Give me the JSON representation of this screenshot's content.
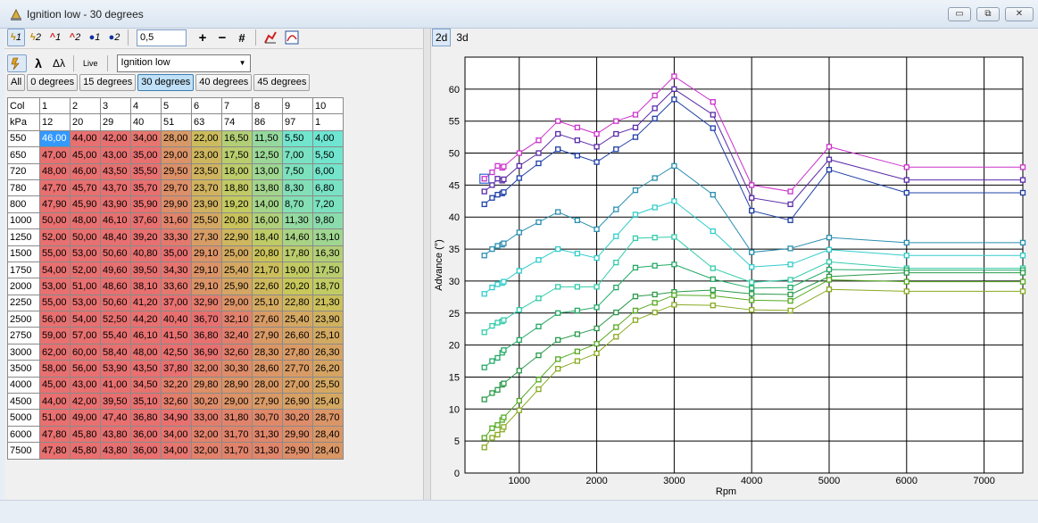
{
  "window": {
    "title": "Ignition low - 30 degrees",
    "buttons": {
      "minimize": "▭",
      "restore": "⧉",
      "close": "✕"
    }
  },
  "toolbar": {
    "buttons": [
      {
        "name": "spark-1",
        "sym": "ϟ",
        "sub": "1",
        "style": "yel",
        "active": true
      },
      {
        "name": "spark-2",
        "sym": "ϟ",
        "sub": "2",
        "style": "yel",
        "active": false
      },
      {
        "name": "red-1",
        "sym": "^",
        "sub": "1",
        "style": "red",
        "active": false
      },
      {
        "name": "red-2",
        "sym": "^",
        "sub": "2",
        "style": "red",
        "active": false
      },
      {
        "name": "blue-1",
        "sym": "●",
        "sub": "1",
        "style": "blue",
        "active": false
      },
      {
        "name": "blue-2",
        "sym": "●",
        "sub": "2",
        "style": "blue",
        "active": false
      }
    ],
    "step_value": "0,5",
    "plus": "+",
    "minus": "−",
    "hash": "#"
  },
  "toolbar2": {
    "lambda": "λ",
    "delta_lambda": "Δλ",
    "live": "Live",
    "map_select": "Ignition low"
  },
  "tabs": [
    {
      "label": "All",
      "active": false
    },
    {
      "label": "0 degrees",
      "active": false
    },
    {
      "label": "15 degrees",
      "active": false
    },
    {
      "label": "30 degrees",
      "active": true
    },
    {
      "label": "40 degrees",
      "active": false
    },
    {
      "label": "45 degrees",
      "active": false
    }
  ],
  "table": {
    "col_label": "Col",
    "cols": [
      "1",
      "2",
      "3",
      "4",
      "5",
      "6",
      "7",
      "8",
      "9",
      "10"
    ],
    "kpa_label": "kPa",
    "kpa": [
      "12",
      "20",
      "29",
      "40",
      "51",
      "63",
      "74",
      "86",
      "97",
      "1"
    ],
    "rows": [
      {
        "rpm": "550",
        "v": [
          "46,00",
          "44,00",
          "42,00",
          "34,00",
          "28,00",
          "22,00",
          "16,50",
          "11,50",
          "5,50",
          "4,00"
        ]
      },
      {
        "rpm": "650",
        "v": [
          "47,00",
          "45,00",
          "43,00",
          "35,00",
          "29,00",
          "23,00",
          "17,50",
          "12,50",
          "7,00",
          "5,50"
        ]
      },
      {
        "rpm": "720",
        "v": [
          "48,00",
          "46,00",
          "43,50",
          "35,50",
          "29,50",
          "23,50",
          "18,00",
          "13,00",
          "7,50",
          "6,00"
        ]
      },
      {
        "rpm": "780",
        "v": [
          "47,70",
          "45,70",
          "43,70",
          "35,70",
          "29,70",
          "23,70",
          "18,80",
          "13,80",
          "8,30",
          "6,80"
        ]
      },
      {
        "rpm": "800",
        "v": [
          "47,90",
          "45,90",
          "43,90",
          "35,90",
          "29,90",
          "23,90",
          "19,20",
          "14,00",
          "8,70",
          "7,20"
        ]
      },
      {
        "rpm": "1000",
        "v": [
          "50,00",
          "48,00",
          "46,10",
          "37,60",
          "31,60",
          "25,50",
          "20,80",
          "16,00",
          "11,30",
          "9,80"
        ]
      },
      {
        "rpm": "1250",
        "v": [
          "52,00",
          "50,00",
          "48,40",
          "39,20",
          "33,30",
          "27,30",
          "22,90",
          "18,40",
          "14,60",
          "13,10"
        ]
      },
      {
        "rpm": "1500",
        "v": [
          "55,00",
          "53,00",
          "50,60",
          "40,80",
          "35,00",
          "29,10",
          "25,00",
          "20,80",
          "17,80",
          "16,30"
        ]
      },
      {
        "rpm": "1750",
        "v": [
          "54,00",
          "52,00",
          "49,60",
          "39,50",
          "34,30",
          "29,10",
          "25,40",
          "21,70",
          "19,00",
          "17,50"
        ]
      },
      {
        "rpm": "2000",
        "v": [
          "53,00",
          "51,00",
          "48,60",
          "38,10",
          "33,60",
          "29,10",
          "25,90",
          "22,60",
          "20,20",
          "18,70"
        ]
      },
      {
        "rpm": "2250",
        "v": [
          "55,00",
          "53,00",
          "50,60",
          "41,20",
          "37,00",
          "32,90",
          "29,00",
          "25,10",
          "22,80",
          "21,30"
        ]
      },
      {
        "rpm": "2500",
        "v": [
          "56,00",
          "54,00",
          "52,50",
          "44,20",
          "40,40",
          "36,70",
          "32,10",
          "27,60",
          "25,40",
          "23,90"
        ]
      },
      {
        "rpm": "2750",
        "v": [
          "59,00",
          "57,00",
          "55,40",
          "46,10",
          "41,50",
          "36,80",
          "32,40",
          "27,90",
          "26,60",
          "25,10"
        ]
      },
      {
        "rpm": "3000",
        "v": [
          "62,00",
          "60,00",
          "58,40",
          "48,00",
          "42,50",
          "36,90",
          "32,60",
          "28,30",
          "27,80",
          "26,30"
        ]
      },
      {
        "rpm": "3500",
        "v": [
          "58,00",
          "56,00",
          "53,90",
          "43,50",
          "37,80",
          "32,00",
          "30,30",
          "28,60",
          "27,70",
          "26,20"
        ]
      },
      {
        "rpm": "4000",
        "v": [
          "45,00",
          "43,00",
          "41,00",
          "34,50",
          "32,20",
          "29,80",
          "28,90",
          "28,00",
          "27,00",
          "25,50"
        ]
      },
      {
        "rpm": "4500",
        "v": [
          "44,00",
          "42,00",
          "39,50",
          "35,10",
          "32,60",
          "30,20",
          "29,00",
          "27,90",
          "26,90",
          "25,40"
        ]
      },
      {
        "rpm": "5000",
        "v": [
          "51,00",
          "49,00",
          "47,40",
          "36,80",
          "34,90",
          "33,00",
          "31,80",
          "30,70",
          "30,20",
          "28,70"
        ]
      },
      {
        "rpm": "6000",
        "v": [
          "47,80",
          "45,80",
          "43,80",
          "36,00",
          "34,00",
          "32,00",
          "31,70",
          "31,30",
          "29,90",
          "28,40"
        ]
      },
      {
        "rpm": "7500",
        "v": [
          "47,80",
          "45,80",
          "43,80",
          "36,00",
          "34,00",
          "32,00",
          "31,70",
          "31,30",
          "29,90",
          "28,40"
        ]
      }
    ]
  },
  "view": {
    "tab_2d": "2d",
    "tab_3d": "3d"
  },
  "chart_data": {
    "type": "line",
    "title": "",
    "xlabel": "Rpm",
    "ylabel": "Advance (°)",
    "xlim": [
      300,
      7500
    ],
    "ylim": [
      0,
      65
    ],
    "xticks": [
      1000,
      2000,
      3000,
      4000,
      5000,
      6000,
      7000
    ],
    "yticks": [
      0,
      5,
      10,
      15,
      20,
      25,
      30,
      35,
      40,
      45,
      50,
      55,
      60
    ],
    "grid": true,
    "x": [
      550,
      650,
      720,
      780,
      800,
      1000,
      1250,
      1500,
      1750,
      2000,
      2250,
      2500,
      2750,
      3000,
      3500,
      4000,
      4500,
      5000,
      6000,
      7500
    ],
    "series": [
      {
        "color": "#cc33cc",
        "values": [
          46,
          47,
          48,
          47.7,
          47.9,
          50,
          52,
          55,
          54,
          53,
          55,
          56,
          59,
          62,
          58,
          45,
          44,
          51,
          47.8,
          47.8
        ]
      },
      {
        "color": "#5a2aa8",
        "values": [
          44,
          45,
          46,
          45.7,
          45.9,
          48,
          50,
          53,
          52,
          51,
          53,
          54,
          57,
          60,
          56,
          43,
          42,
          49,
          45.8,
          45.8
        ]
      },
      {
        "color": "#1f3fa6",
        "values": [
          42,
          43,
          43.5,
          43.7,
          43.9,
          46.1,
          48.4,
          50.6,
          49.6,
          48.6,
          50.6,
          52.5,
          55.4,
          58.4,
          53.9,
          41,
          39.5,
          47.4,
          43.8,
          43.8
        ]
      },
      {
        "color": "#2a8fb0",
        "values": [
          34,
          35,
          35.5,
          35.7,
          35.9,
          37.6,
          39.2,
          40.8,
          39.5,
          38.1,
          41.2,
          44.2,
          46.1,
          48,
          43.5,
          34.5,
          35.1,
          36.8,
          36,
          36
        ]
      },
      {
        "color": "#33cccc",
        "values": [
          28,
          29,
          29.5,
          29.7,
          29.9,
          31.6,
          33.3,
          35,
          34.3,
          33.6,
          37,
          40.4,
          41.5,
          42.5,
          37.8,
          32.2,
          32.6,
          34.9,
          34,
          34
        ]
      },
      {
        "color": "#33ccaa",
        "values": [
          22,
          23,
          23.5,
          23.7,
          23.9,
          25.5,
          27.3,
          29.1,
          29.1,
          29.1,
          32.9,
          36.7,
          36.8,
          36.9,
          32,
          29.8,
          30.2,
          33,
          32,
          32
        ]
      },
      {
        "color": "#22aa66",
        "values": [
          16.5,
          17.5,
          18,
          18.8,
          19.2,
          20.8,
          22.9,
          25,
          25.4,
          25.9,
          29,
          32.1,
          32.4,
          32.6,
          30.3,
          28.9,
          29,
          31.8,
          31.7,
          31.7
        ]
      },
      {
        "color": "#2a9a4a",
        "values": [
          11.5,
          12.5,
          13,
          13.8,
          14,
          16,
          18.4,
          20.8,
          21.7,
          22.6,
          25.1,
          27.6,
          27.9,
          28.3,
          28.6,
          28,
          27.9,
          30.7,
          31.3,
          31.3
        ]
      },
      {
        "color": "#55aa22",
        "values": [
          5.5,
          7,
          7.5,
          8.3,
          8.7,
          11.3,
          14.6,
          17.8,
          19,
          20.2,
          22.8,
          25.4,
          26.6,
          27.8,
          27.7,
          27,
          26.9,
          30.2,
          29.9,
          29.9
        ]
      },
      {
        "color": "#88aa22",
        "values": [
          4,
          5.5,
          6,
          6.8,
          7.2,
          9.8,
          13.1,
          16.3,
          17.5,
          18.7,
          21.3,
          23.9,
          25.1,
          26.3,
          26.2,
          25.5,
          25.4,
          28.7,
          28.4,
          28.4
        ]
      }
    ]
  },
  "colors": {
    "low": "#6ee6d2",
    "mid": "#c8c85a",
    "high": "#e87070",
    "accent": "#3399ff"
  }
}
